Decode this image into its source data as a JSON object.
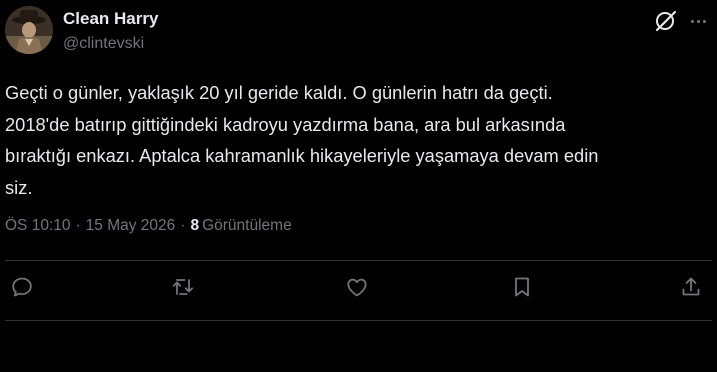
{
  "user": {
    "display_name": "Clean Harry",
    "handle": "@clintevski",
    "avatar_icon": "cowboy-avatar"
  },
  "tweet": {
    "lines": [
      "Geçti o günler, yaklaşık 20 yıl geride kaldı. O günlerin hatrı da geçti.",
      "2018'de batırıp gittiğindeki kadroyu yazdırma bana, ara bul arkasında",
      "bıraktığı enkazı. Aptalca kahramanlık hikayeleriyle yaşamaya devam edin",
      "siz."
    ]
  },
  "meta": {
    "time": "ÖS 10:10",
    "separator": "·",
    "date": "15 May 2026",
    "views_count": "8",
    "views_label": "Görüntüleme"
  },
  "icons": {
    "grok": "grok-icon",
    "more": "more-icon",
    "reply": "reply-icon",
    "retweet": "retweet-icon",
    "like": "like-icon",
    "bookmark": "bookmark-icon",
    "share": "share-icon"
  },
  "colors": {
    "background": "#000000",
    "text": "#e7e9ea",
    "secondary": "#71767b",
    "divider": "#2f3336"
  }
}
